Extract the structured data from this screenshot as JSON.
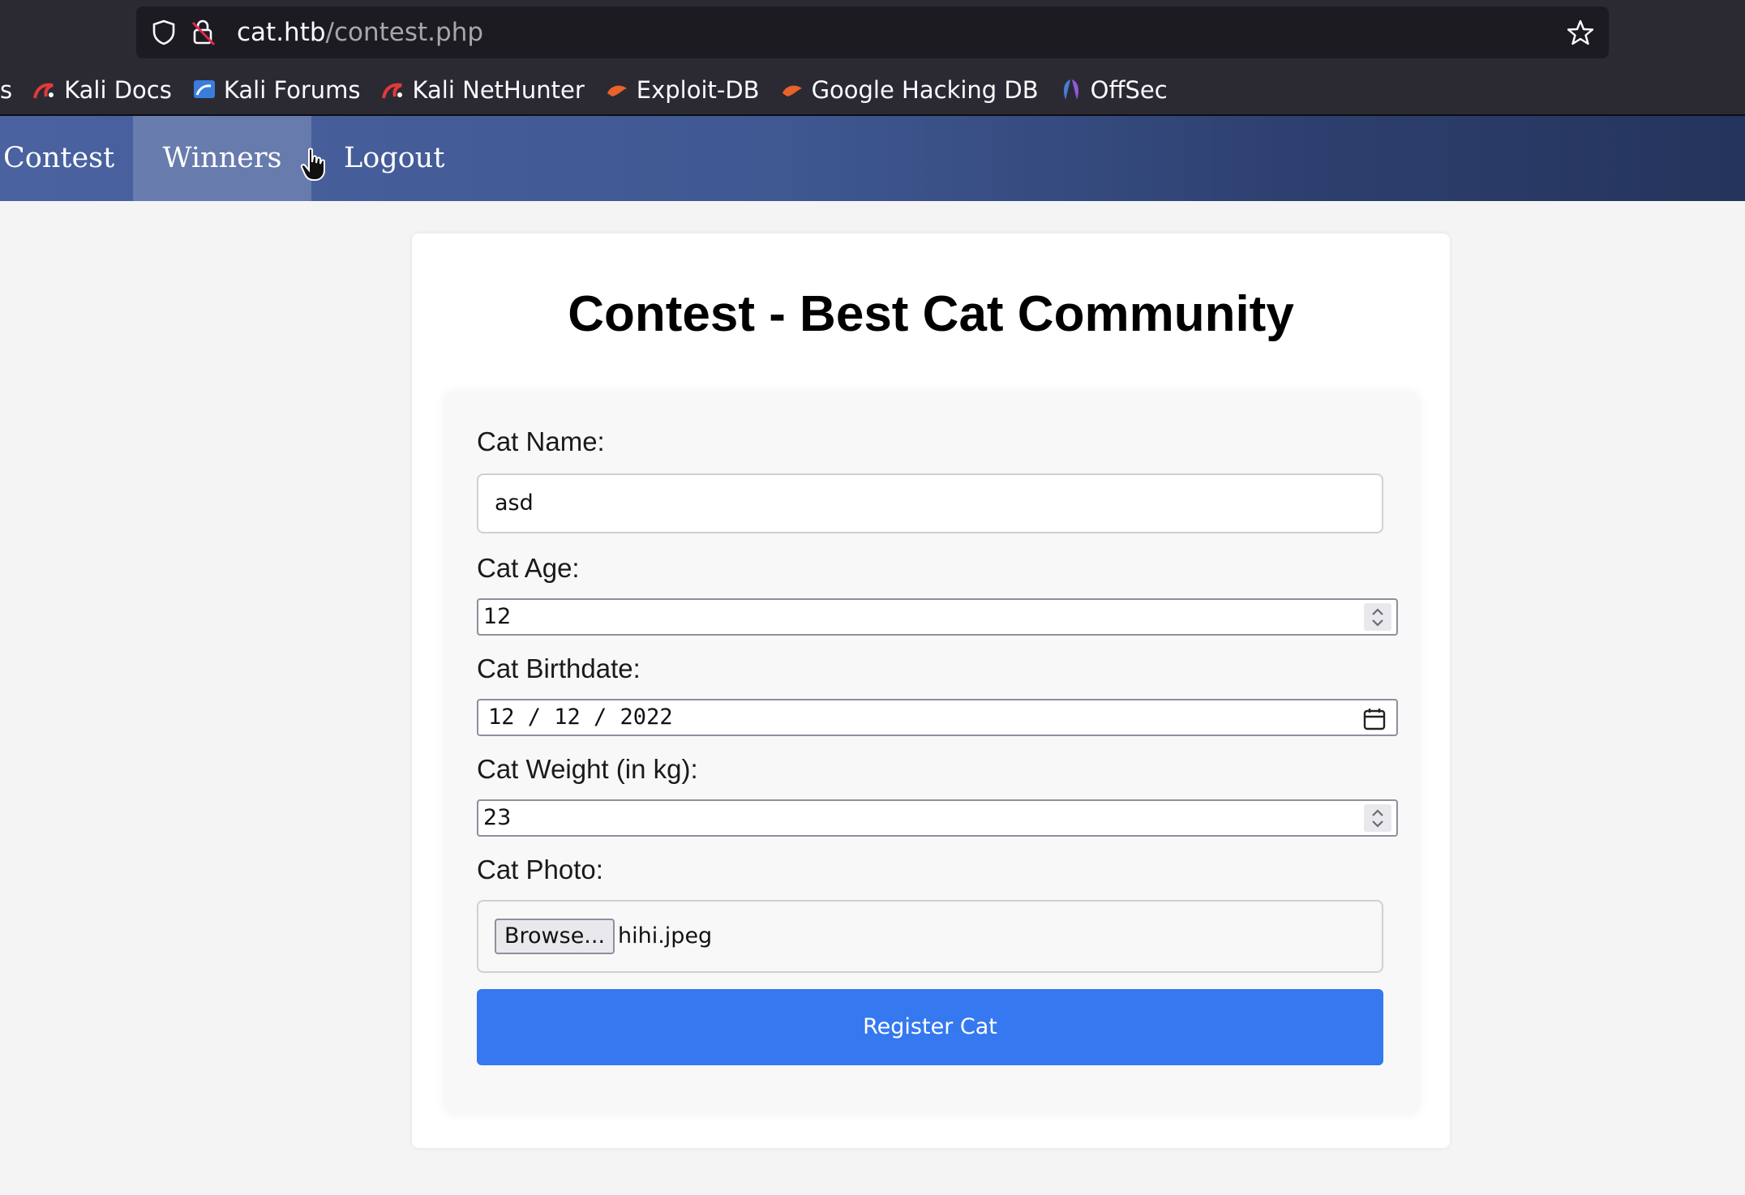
{
  "browser": {
    "url_host": "cat.htb",
    "url_path": "/contest.php",
    "bookmarks_partial": "s",
    "bookmarks": [
      {
        "label": "Kali Docs",
        "icon": "kali-dragon-icon"
      },
      {
        "label": "Kali Forums",
        "icon": "kali-forums-icon"
      },
      {
        "label": "Kali NetHunter",
        "icon": "kali-dragon-icon"
      },
      {
        "label": "Exploit-DB",
        "icon": "exploit-db-icon"
      },
      {
        "label": "Google Hacking DB",
        "icon": "exploit-db-icon"
      },
      {
        "label": "OffSec",
        "icon": "offsec-icon"
      }
    ]
  },
  "nav": {
    "contest": "Contest",
    "winners": "Winners",
    "logout": "Logout"
  },
  "page": {
    "title": "Contest - Best Cat Community"
  },
  "form": {
    "name_label": "Cat Name:",
    "name_value": "asd",
    "age_label": "Cat Age:",
    "age_value": "12",
    "birthdate_label": "Cat Birthdate:",
    "birthdate_value": "12 / 12 / 2022",
    "weight_label": "Cat Weight (in kg):",
    "weight_value": "23",
    "photo_label": "Cat Photo:",
    "browse_label": "Browse...",
    "photo_filename": "hihi.jpeg",
    "submit_label": "Register Cat"
  },
  "colors": {
    "chrome_bg": "#2b2a33",
    "nav_gradient_start": "#4a62a0",
    "nav_gradient_end": "#24345c",
    "submit_button": "#3578ef"
  }
}
